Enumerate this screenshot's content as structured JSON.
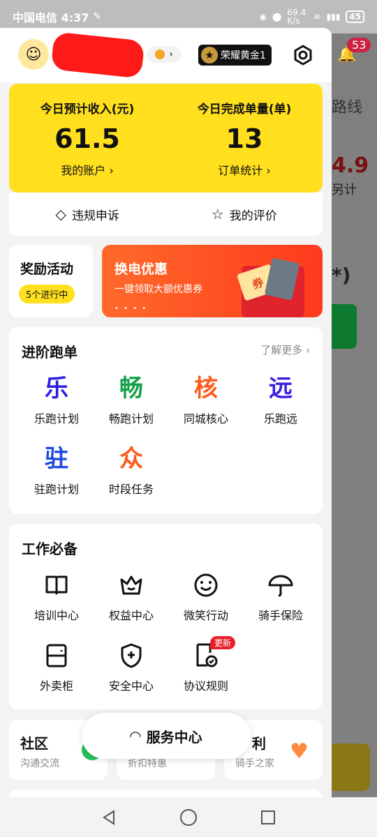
{
  "status": {
    "carrier_time": "中国电信 4:37",
    "speed": "69.4 K/s",
    "battery": "45"
  },
  "background": {
    "badge": "53",
    "route": "路线",
    "value": "4.9",
    "sub": "另计",
    "paren": "*)"
  },
  "profile": {
    "rank_label": "荣耀黄金1"
  },
  "summary": {
    "income_title": "今日预计收入(元)",
    "income_value": "61.5",
    "account_link": "我的账户",
    "orders_title": "今日完成单量(单)",
    "orders_value": "13",
    "orders_link": "订单统计"
  },
  "actions": {
    "appeal": "违规申诉",
    "review": "我的评价"
  },
  "reward": {
    "title": "奖励活动",
    "pill": "5个进行中"
  },
  "banner": {
    "title": "换电优惠",
    "subtitle": "一键领取大额优惠券",
    "coupon": "券"
  },
  "advanced": {
    "title": "进阶跑单",
    "more": "了解更多",
    "items": [
      {
        "glyph": "乐",
        "label": "乐跑计划",
        "color": "#2a20e0"
      },
      {
        "glyph": "畅",
        "label": "畅跑计划",
        "color": "#14a04a"
      },
      {
        "glyph": "核",
        "label": "同城核心",
        "color": "#ff5a1a"
      },
      {
        "glyph": "远",
        "label": "乐跑远",
        "color": "#3a20e0"
      },
      {
        "glyph": "驻",
        "label": "驻跑计划",
        "color": "#1a4ae0"
      },
      {
        "glyph": "众",
        "label": "时段任务",
        "color": "#ff5a1a"
      }
    ]
  },
  "essentials": {
    "title": "工作必备",
    "items": [
      {
        "label": "培训中心",
        "icon": "book-icon"
      },
      {
        "label": "权益中心",
        "icon": "crown-icon"
      },
      {
        "label": "微笑行动",
        "icon": "smile-icon"
      },
      {
        "label": "骑手保险",
        "icon": "umbrella-icon"
      },
      {
        "label": "外卖柜",
        "icon": "locker-icon"
      },
      {
        "label": "安全中心",
        "icon": "shield-icon"
      },
      {
        "label": "协议规则",
        "icon": "document-icon",
        "badge": "更新"
      }
    ]
  },
  "bottom": {
    "community_title": "社区",
    "community_sub": "沟通交流",
    "middle_sub": "折扣特惠",
    "welfare_title": "利",
    "welfare_sub": "骑手之家",
    "service_button": "服务中心"
  }
}
